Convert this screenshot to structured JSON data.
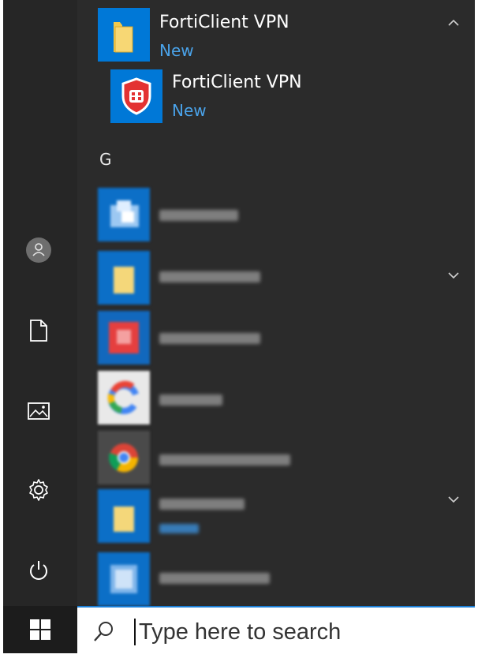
{
  "start_menu": {
    "app_list": {
      "expanded_folder": {
        "label": "FortiClient VPN",
        "badge": "New",
        "tile_color": "#0078d7",
        "icon": "folder-icon"
      },
      "folder_child": {
        "label": "FortiClient VPN",
        "badge": "New",
        "tile_color": "#0078d7",
        "icon": "forticlient-shield-icon"
      },
      "section_letter": "G",
      "blurred_items": [
        {
          "icon": "app-icon",
          "kind": "app"
        },
        {
          "icon": "folder-icon",
          "kind": "folder"
        },
        {
          "icon": "app-icon",
          "kind": "app"
        },
        {
          "icon": "google-icon",
          "kind": "app"
        },
        {
          "icon": "chrome-icon",
          "kind": "app"
        },
        {
          "icon": "folder-icon",
          "kind": "folder",
          "has_badge": true
        },
        {
          "icon": "app-icon",
          "kind": "app"
        }
      ]
    },
    "rail": [
      "user-icon",
      "documents-icon",
      "pictures-icon",
      "settings-icon",
      "power-icon"
    ]
  },
  "taskbar": {
    "search": {
      "placeholder": "Type here to search"
    },
    "start_icon": "windows-logo-icon"
  },
  "colors": {
    "accent": "#0078d7",
    "badge_text": "#4aa3ea",
    "menu_bg": "#2b2b2b",
    "taskbar_bg": "#1c1c1c"
  }
}
